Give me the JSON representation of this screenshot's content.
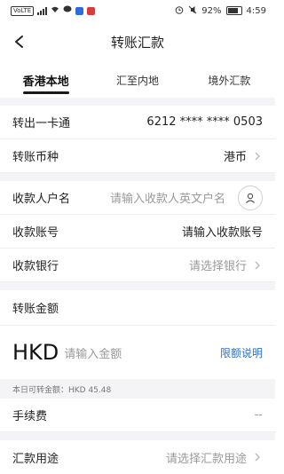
{
  "status": {
    "volte": "VoLTE",
    "battery": "92%",
    "time": "4:59"
  },
  "nav": {
    "title": "转账汇款"
  },
  "tabs": [
    {
      "label": "香港本地",
      "active": true
    },
    {
      "label": "汇至内地",
      "active": false
    },
    {
      "label": "境外汇款",
      "active": false
    }
  ],
  "form": {
    "from_label": "转出一卡通",
    "from_value": "6212 **** **** 0503",
    "currency_label": "转账币种",
    "currency_value": "港币",
    "payee_name_label": "收款人户名",
    "payee_name_placeholder": "请输入收款人英文户名",
    "payee_account_label": "收款账号",
    "payee_account_placeholder": "请输入收款账号",
    "payee_bank_label": "收款银行",
    "payee_bank_placeholder": "请选择银行",
    "amount_section_label": "转账金额",
    "amount_currency": "HKD",
    "amount_placeholder": "请输入金额",
    "limit_link": "限额说明",
    "available_text": "本日可转金额：HKD 45.48",
    "fee_label": "手续费",
    "fee_value": "--",
    "purpose_label": "汇款用途",
    "purpose_placeholder": "请选择汇款用途"
  },
  "colors": {
    "link": "#2f6fd1",
    "placeholder": "#9a9a9a",
    "section_bg": "#f4f4f6"
  }
}
